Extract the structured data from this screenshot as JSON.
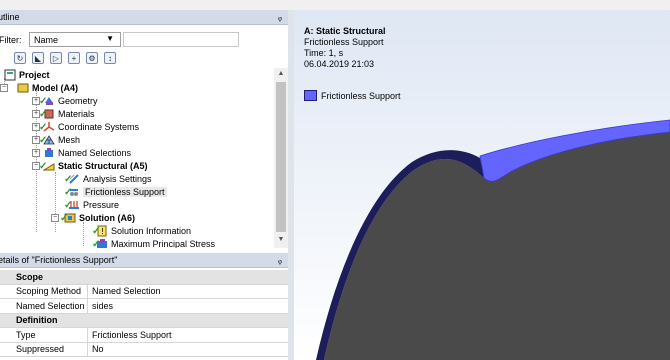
{
  "outline": {
    "title": "utline",
    "pin": "ᵩ",
    "filter_label": "Filter:",
    "filter_value": "Name",
    "filter_caret": "▼",
    "tree": {
      "project": "Project",
      "model": "Model (A4)",
      "geometry": "Geometry",
      "materials": "Materials",
      "coordinate_systems": "Coordinate Systems",
      "mesh": "Mesh",
      "named_selections": "Named Selections",
      "static_structural": "Static Structural (A5)",
      "analysis_settings": "Analysis Settings",
      "frictionless_support": "Frictionless Support",
      "pressure": "Pressure",
      "solution": "Solution (A6)",
      "solution_information": "Solution Information",
      "max_principal_stress": "Maximum Principal Stress"
    }
  },
  "details": {
    "title": "etails of \"Frictionless Support\"",
    "pin": "ᵩ",
    "sections": {
      "scope": "Scope",
      "definition": "Definition"
    },
    "rows": {
      "scoping_method_k": "Scoping Method",
      "scoping_method_v": "Named Selection",
      "named_selection_k": "Named Selection",
      "named_selection_v": "sides",
      "type_k": "Type",
      "type_v": "Frictionless Support",
      "suppressed_k": "Suppressed",
      "suppressed_v": "No"
    }
  },
  "viewport": {
    "title": "A: Static Structural",
    "subtitle": "Frictionless Support",
    "time": "Time: 1, s",
    "date": "06.04.2019 21:03",
    "legend_label": "Frictionless Support",
    "colors": {
      "support": "#6464ff",
      "body": "#4a4a4a",
      "edge": "#1d1d5a"
    }
  }
}
